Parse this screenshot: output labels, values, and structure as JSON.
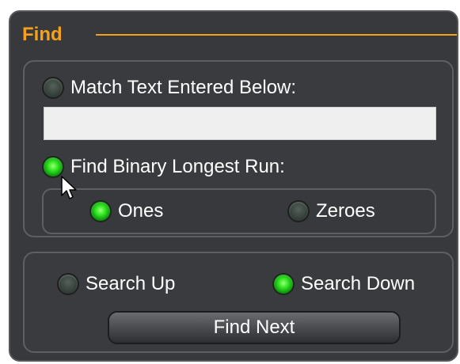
{
  "find_panel": {
    "title": "Find",
    "accent_color": "#f7a11a",
    "match_text_option": {
      "label": "Match Text Entered Below:",
      "selected": false
    },
    "search_text": {
      "value": "",
      "placeholder": ""
    },
    "binary_run_option": {
      "label": "Find Binary Longest Run:",
      "selected": true
    },
    "run_type": {
      "ones": {
        "label": "Ones",
        "selected": true
      },
      "zeroes": {
        "label": "Zeroes",
        "selected": false
      }
    }
  },
  "search_panel": {
    "direction": {
      "up": {
        "label": "Search Up",
        "selected": false
      },
      "down": {
        "label": "Search Down",
        "selected": true
      }
    },
    "find_next_label": "Find Next"
  },
  "icons": {
    "radio_on_color": "#2ee51e",
    "radio_off_color": "#38433e",
    "cursor": "arrow-cursor-icon"
  }
}
